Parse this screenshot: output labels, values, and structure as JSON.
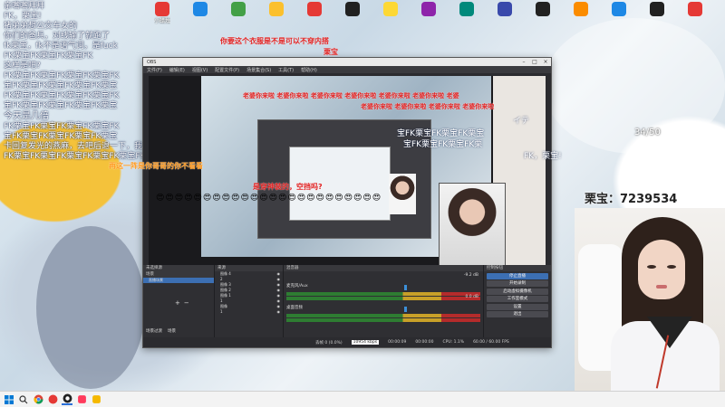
{
  "desktop": {
    "icons": [
      {
        "label": "小蜡烛",
        "color": "#e53935"
      },
      {
        "label": "",
        "color": "#1e88e5"
      },
      {
        "label": "",
        "color": "#43a047"
      },
      {
        "label": "",
        "color": "#fbc02d"
      },
      {
        "label": "",
        "color": "#e53935"
      },
      {
        "label": "",
        "color": "#212121"
      },
      {
        "label": "",
        "color": "#fdd835"
      },
      {
        "label": "",
        "color": "#8e24aa"
      },
      {
        "label": "",
        "color": "#00897b"
      },
      {
        "label": "",
        "color": "#3949ab"
      },
      {
        "label": "",
        "color": "#212121"
      },
      {
        "label": "",
        "color": "#fb8c00"
      },
      {
        "label": "",
        "color": "#1e88e5"
      },
      {
        "label": "",
        "color": "#212121"
      },
      {
        "label": "",
        "color": "#e53935"
      },
      {
        "label": "",
        "color": "#00acc1"
      }
    ]
  },
  "chat": {
    "lines": [
      "亲嘴嘴拜拜",
      "FK，栗宝!",
      "猪弟弟想公交车女的",
      "你们的爸兵，对线输了就跑了",
      "fk栗宝，fk不是语气词，是fuck",
      "FK栗宝FK栗宝FK栗宝FK",
      "这样是吧?",
      "FK栗宝FK栗宝FK栗宝FK栗宝FK",
      "宝FK栗宝FK栗宝FK栗宝FK栗宝",
      "FK栗宝FK栗宝FK栗宝FK栗宝FK",
      "宝FK栗宝FK栗宝FK栗宝FK栗宝",
      "今天是几倍",
      "FK栗宝FK栗宝FK栗宝FK栗宝FK",
      "宝FK栗宝FK栗宝FK栗宝FK栗宝",
      "卡回复发光的燕麻，去吧后退一下，我要出来了",
      "FK栗宝FK栗宝FK栗宝FK栗宝FK栗宝FK"
    ]
  },
  "danmaku": {
    "red1": "你要这个衣服是不是可以不穿内搭",
    "red1b": "栗宝",
    "red_repeat": "老婆你来啦 老婆你来啦 老婆你来啦 老婆你来啦 老婆你来啦 老婆你来啦 老婆",
    "red_repeat2": "老婆你来啦 老婆你来啦 老婆你来啦 老婆你来啦",
    "red_bottom": "是穿神装的，空挡吗?",
    "orange": "再这一阵是你哥哥的你不看看",
    "right_fk1": "宝FK栗宝FK栗宝FK栗宝",
    "right_fk2": "宝FK栗宝FK栗宝FK栗",
    "right_fk3": "FK，栗宝!",
    "itte": "イテ",
    "emoji": "😍😍😍😍😍😍😍😍😍😍😍😍😍😍😍😍😍😍😍😍😍😍😍😍"
  },
  "obs": {
    "title": "OBS",
    "menu": [
      "文件(F)",
      "编辑(E)",
      "视图(V)",
      "配置文件(P)",
      "场景集合(S)",
      "工具(T)",
      "帮助(H)"
    ],
    "panels": {
      "scenes_header": "场景",
      "scenes_tabs": [
        "场景过渡",
        "场景"
      ],
      "scene_item": "直播场景",
      "sources_header": "来源",
      "sources": [
        "图像 4",
        "2",
        "图像 3",
        "图像 2",
        "图像 1",
        "1",
        "图像",
        "1"
      ],
      "mixer_header": "混音器",
      "mixer_tracks": [
        "麦克风/Aux",
        "桌面音频"
      ],
      "mixer_db": [
        "-9.2 dB",
        "0.0 dB"
      ],
      "controls_header": "控制按钮",
      "controls": [
        "停止直播",
        "开始录制",
        "启动虚拟摄像机",
        "工作室模式",
        "设置",
        "退出"
      ],
      "not_selected": "未选择源"
    },
    "status": {
      "dropped": "丢帧 0 (0.0%)",
      "kbps": "10954 kbps",
      "live": "00:00:09",
      "rec": "00:00:00",
      "cpu": "CPU: 1.1%",
      "fps": "60.00 / 60.00 FPS"
    }
  },
  "stream": {
    "fans_label": "栗宝：7239534",
    "counter": "34/50"
  },
  "taskbar": {
    "icons": [
      "windows-start",
      "search",
      "chrome",
      "app-red",
      "app-dark",
      "app-red2",
      "app-yellow"
    ]
  }
}
